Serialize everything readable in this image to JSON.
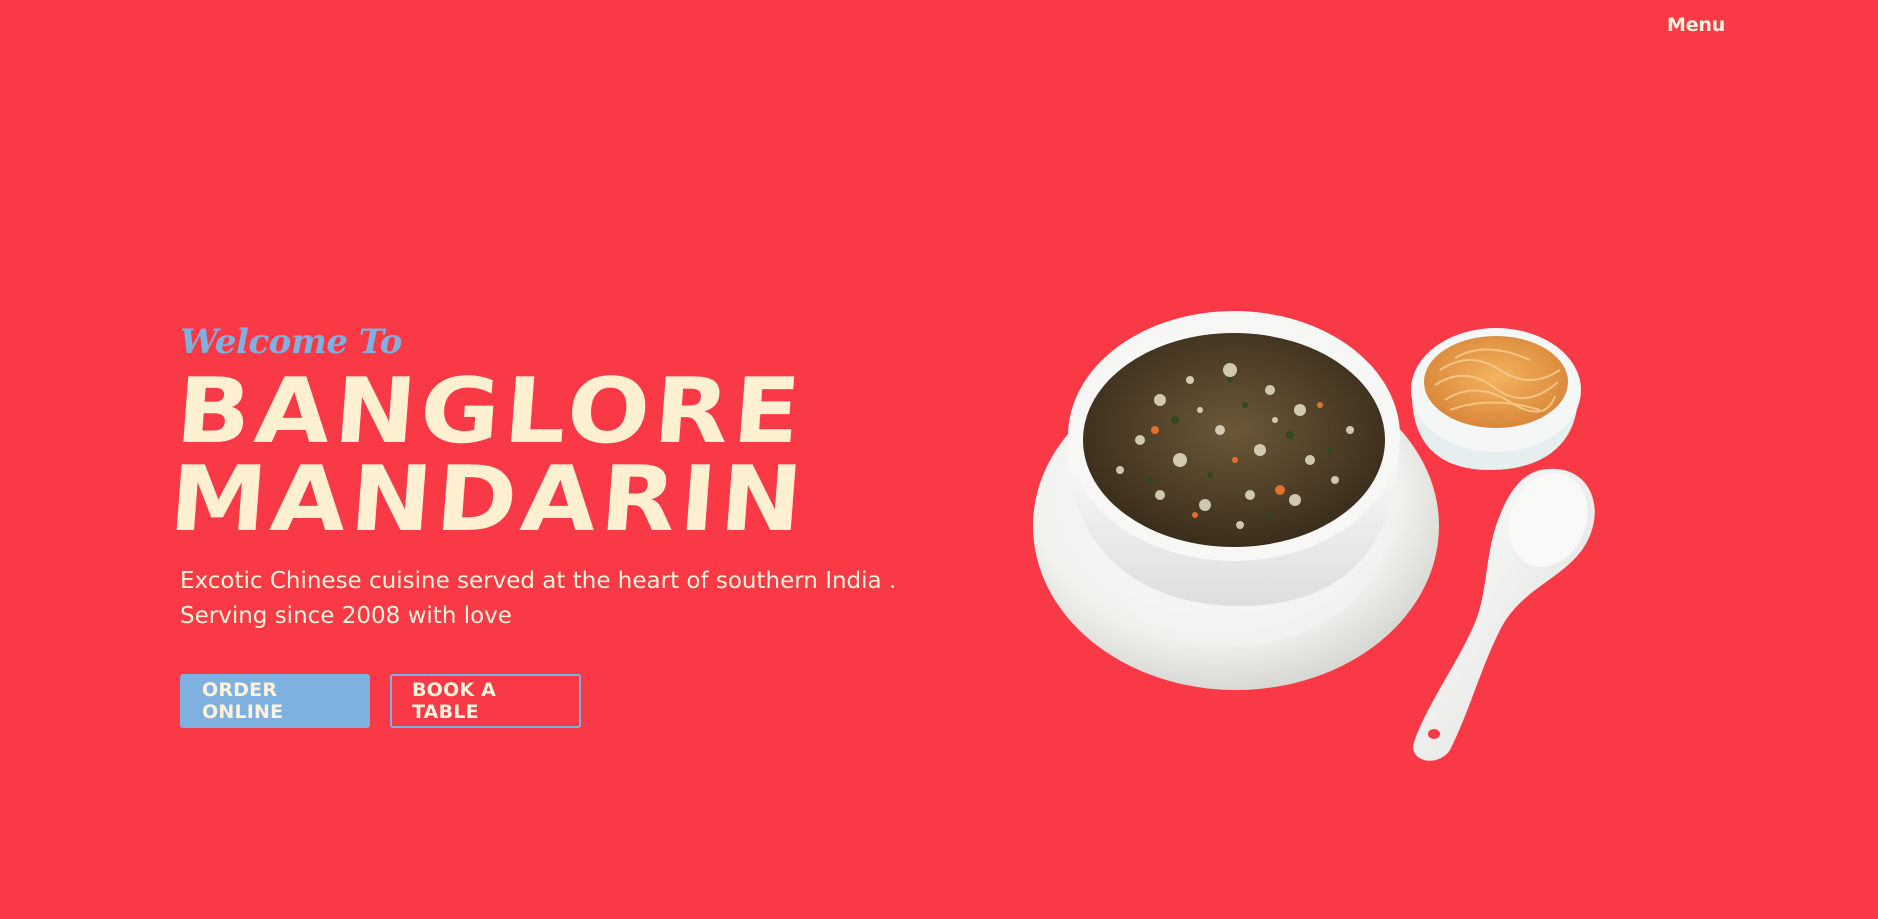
{
  "nav": {
    "menu_label": "Menu"
  },
  "hero": {
    "welcome": "Welcome To",
    "title_line1": "BANGLORE",
    "title_line2": "MANDARIN",
    "tagline_line1": "Excotic Chinese cuisine served at the heart of southern India .",
    "tagline_line2": "Serving since 2008 with love"
  },
  "actions": {
    "order_label": "ORDER ONLINE",
    "book_label": "BOOK A TABLE"
  },
  "colors": {
    "background": "#fa3946",
    "accent_blue": "#7eb0e0",
    "cream": "#fff0d2"
  },
  "image": {
    "subject": "soup-bowl-with-noodles-and-spoon"
  }
}
